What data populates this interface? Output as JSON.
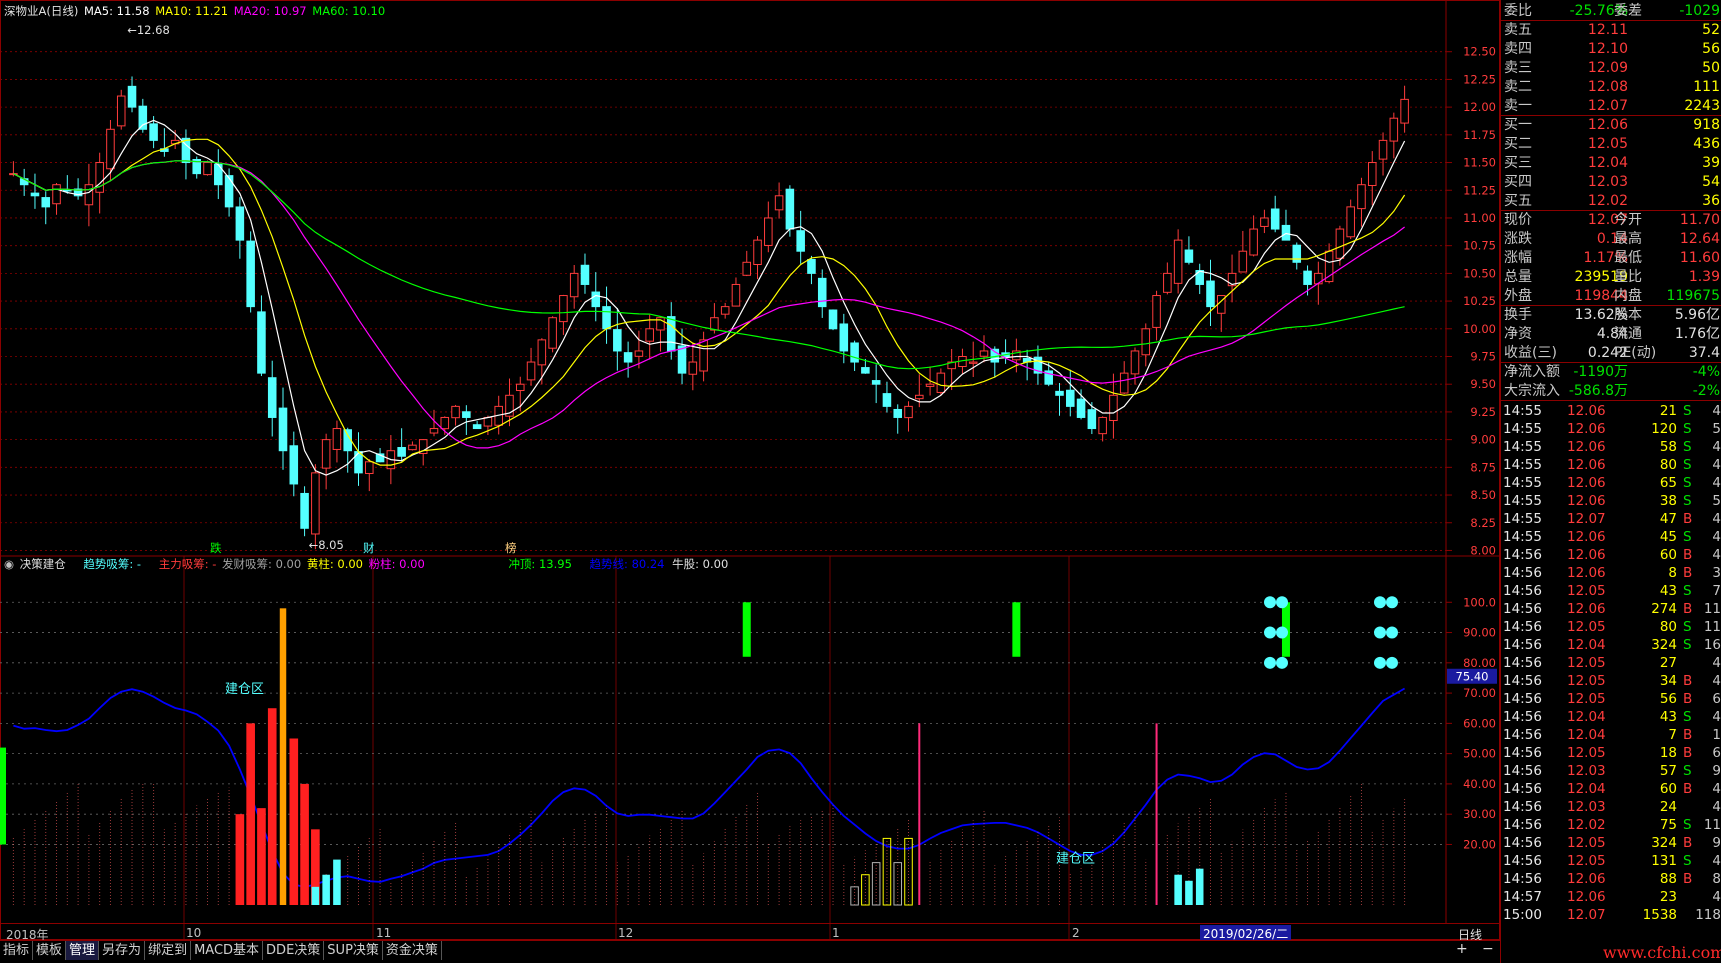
{
  "colors": {
    "up": "#ff3c3c",
    "down": "#54ffff",
    "ma5": "#ffffff",
    "ma10": "#ffff00",
    "ma20": "#ff00ff",
    "ma60": "#00ff00",
    "trend_line": "#0000ff",
    "grid": "#8b0000"
  },
  "main_legend": {
    "title": "深物业A(日线)",
    "ma5": "MA5: 11.58",
    "ma10": "MA10: 11.21",
    "ma20": "MA20: 10.97",
    "ma60": "MA60: 10.10"
  },
  "indicator_legend": {
    "name": "决策建仓",
    "trend": "趋势吸筹: -",
    "main_force": "主力吸筹: -",
    "fortune": "发财吸筹: 0.00",
    "yellow_col": "黄柱: 0.00",
    "pink_col": "粉柱: 0.00",
    "top": "冲顶: 13.95",
    "trend_line": "趋势线: 80.24",
    "bull": "牛股: 0.00"
  },
  "annotations": {
    "high_label": "12.68",
    "low_label": "8.05",
    "event_die": "跌",
    "event_cai": "财",
    "event_bang": "榜",
    "build_zone_1": "建仓区",
    "build_zone_2": "建仓区",
    "current_value": "75.40"
  },
  "price_axis": [
    "12.50",
    "12.25",
    "12.00",
    "11.75",
    "11.50",
    "11.25",
    "11.00",
    "10.75",
    "10.50",
    "10.25",
    "10.00",
    "9.75",
    "9.50",
    "9.25",
    "9.00",
    "8.75",
    "8.50",
    "8.25",
    "8.00"
  ],
  "indicator_axis": [
    "100.0",
    "90.00",
    "80.00",
    "70.00",
    "60.00",
    "50.00",
    "40.00",
    "30.00",
    "20.00"
  ],
  "date_axis": {
    "labels": [
      "2018年",
      "10",
      "11",
      "12",
      "1",
      "2"
    ],
    "cursor_date": "2019/02/26/二",
    "period": "日线"
  },
  "chart_data": {
    "type": "candlestick",
    "title": "深物业A(日线)",
    "ylim": [
      7.95,
      12.75
    ],
    "high": 12.68,
    "low": 8.05,
    "close": [
      11.4,
      11.3,
      11.2,
      11.1,
      11.3,
      11.25,
      11.2,
      11.3,
      11.5,
      11.8,
      12.1,
      12.0,
      11.8,
      11.7,
      11.6,
      11.7,
      11.5,
      11.4,
      11.5,
      11.3,
      11.1,
      10.8,
      10.2,
      9.6,
      9.2,
      8.9,
      8.6,
      8.2,
      8.7,
      9.0,
      9.1,
      8.9,
      8.7,
      8.8,
      8.8,
      8.9,
      8.85,
      8.95,
      9.0,
      9.1,
      9.2,
      9.3,
      9.2,
      9.1,
      9.2,
      9.3,
      9.4,
      9.5,
      9.7,
      9.9,
      10.1,
      10.3,
      10.5,
      10.4,
      10.2,
      10.0,
      9.8,
      9.7,
      9.8,
      10.0,
      10.1,
      9.8,
      9.6,
      9.7,
      9.9,
      10.1,
      10.2,
      10.4,
      10.6,
      10.8,
      11.0,
      11.2,
      10.9,
      10.7,
      10.5,
      10.2,
      10.0,
      9.8,
      9.7,
      9.6,
      9.5,
      9.3,
      9.2,
      9.3,
      9.4,
      9.5,
      9.6,
      9.7,
      9.75,
      9.7,
      9.8,
      9.7,
      9.75,
      9.8,
      9.7,
      9.6,
      9.5,
      9.4,
      9.3,
      9.2,
      9.1,
      9.2,
      9.4,
      9.6,
      9.8,
      10.0,
      10.3,
      10.5,
      10.8,
      10.6,
      10.4,
      10.2,
      10.3,
      10.5,
      10.7,
      10.9,
      11.0,
      10.9,
      10.8,
      10.6,
      10.4,
      10.5,
      10.7,
      10.9,
      11.1,
      11.3,
      11.5,
      11.7,
      11.9,
      12.07
    ],
    "series": [
      {
        "name": "MA5",
        "last": 11.58
      },
      {
        "name": "MA10",
        "last": 11.21
      },
      {
        "name": "MA20",
        "last": 10.97
      },
      {
        "name": "MA60",
        "last": 10.1
      }
    ]
  },
  "right_panel": {
    "header": [
      {
        "l": "委比",
        "v": "-25.76%",
        "vc": "green",
        "l2": "委差",
        "v2": "-1029",
        "v2c": "green"
      }
    ],
    "asks": [
      {
        "l": "卖五",
        "p": "12.11",
        "q": "52"
      },
      {
        "l": "卖四",
        "p": "12.10",
        "q": "56"
      },
      {
        "l": "卖三",
        "p": "12.09",
        "q": "50"
      },
      {
        "l": "卖二",
        "p": "12.08",
        "q": "111"
      },
      {
        "l": "卖一",
        "p": "12.07",
        "q": "2243"
      }
    ],
    "bids": [
      {
        "l": "买一",
        "p": "12.06",
        "q": "918"
      },
      {
        "l": "买二",
        "p": "12.05",
        "q": "436"
      },
      {
        "l": "买三",
        "p": "12.04",
        "q": "39"
      },
      {
        "l": "买四",
        "p": "12.03",
        "q": "54"
      },
      {
        "l": "买五",
        "p": "12.02",
        "q": "36"
      }
    ],
    "stats": [
      {
        "l": "现价",
        "v": "12.07",
        "vc": "red",
        "l2": "今开",
        "v2": "11.70",
        "v2c": "red"
      },
      {
        "l": "涨跌",
        "v": "0.14",
        "vc": "red",
        "l2": "最高",
        "v2": "12.64",
        "v2c": "red"
      },
      {
        "l": "涨幅",
        "v": "1.17%",
        "vc": "red",
        "l2": "最低",
        "v2": "11.60",
        "v2c": "red"
      },
      {
        "l": "总量",
        "v": "239519",
        "vc": "yellow",
        "l2": "量比",
        "v2": "1.39",
        "v2c": "red"
      },
      {
        "l": "外盘",
        "v": "119844",
        "vc": "red",
        "l2": "内盘",
        "v2": "119675",
        "v2c": "green"
      }
    ],
    "stats2": [
      {
        "l": "换手",
        "v": "13.62%",
        "vc": "white",
        "l2": "股本",
        "v2": "5.96亿",
        "v2c": "white"
      },
      {
        "l": "净资",
        "v": "4.84",
        "vc": "white",
        "l2": "流通",
        "v2": "1.76亿",
        "v2c": "white"
      },
      {
        "l": "收益(三)",
        "v": "0.242",
        "vc": "white",
        "l2": "PE(动)",
        "v2": "37.4",
        "v2c": "white"
      }
    ],
    "flows": [
      {
        "l": "净流入额",
        "v": "-1190万",
        "vc": "green",
        "v2": "-4%",
        "v2c": "green"
      },
      {
        "l": "大宗流入",
        "v": "-586.8万",
        "vc": "green",
        "v2": "-2%",
        "v2c": "green"
      }
    ],
    "ticks": [
      {
        "t": "14:55",
        "p": "12.06",
        "pc": "red",
        "q": "21",
        "s": "S",
        "sc": "green",
        "n": "4"
      },
      {
        "t": "14:55",
        "p": "12.06",
        "pc": "red",
        "q": "120",
        "s": "S",
        "sc": "green",
        "n": "5"
      },
      {
        "t": "14:55",
        "p": "12.06",
        "pc": "red",
        "q": "58",
        "s": "S",
        "sc": "green",
        "n": "4"
      },
      {
        "t": "14:55",
        "p": "12.06",
        "pc": "red",
        "q": "80",
        "s": "S",
        "sc": "green",
        "n": "4"
      },
      {
        "t": "14:55",
        "p": "12.06",
        "pc": "red",
        "q": "65",
        "s": "S",
        "sc": "green",
        "n": "4"
      },
      {
        "t": "14:55",
        "p": "12.06",
        "pc": "red",
        "q": "38",
        "s": "S",
        "sc": "green",
        "n": "5"
      },
      {
        "t": "14:55",
        "p": "12.07",
        "pc": "red",
        "q": "47",
        "s": "B",
        "sc": "red",
        "n": "4"
      },
      {
        "t": "14:55",
        "p": "12.06",
        "pc": "red",
        "q": "45",
        "s": "S",
        "sc": "green",
        "n": "4"
      },
      {
        "t": "14:56",
        "p": "12.06",
        "pc": "red",
        "q": "60",
        "s": "B",
        "sc": "red",
        "n": "4"
      },
      {
        "t": "14:56",
        "p": "12.06",
        "pc": "red",
        "q": "8",
        "s": "B",
        "sc": "red",
        "n": "3"
      },
      {
        "t": "14:56",
        "p": "12.05",
        "pc": "red",
        "q": "43",
        "s": "S",
        "sc": "green",
        "n": "7"
      },
      {
        "t": "14:56",
        "p": "12.06",
        "pc": "red",
        "q": "274",
        "s": "B",
        "sc": "red",
        "n": "11"
      },
      {
        "t": "14:56",
        "p": "12.05",
        "pc": "red",
        "q": "80",
        "s": "S",
        "sc": "green",
        "n": "11"
      },
      {
        "t": "14:56",
        "p": "12.04",
        "pc": "red",
        "q": "324",
        "s": "S",
        "sc": "green",
        "n": "16"
      },
      {
        "t": "14:56",
        "p": "12.05",
        "pc": "red",
        "q": "27",
        "s": "",
        "sc": "red",
        "n": "4"
      },
      {
        "t": "14:56",
        "p": "12.05",
        "pc": "red",
        "q": "34",
        "s": "B",
        "sc": "red",
        "n": "4"
      },
      {
        "t": "14:56",
        "p": "12.05",
        "pc": "red",
        "q": "56",
        "s": "B",
        "sc": "red",
        "n": "6"
      },
      {
        "t": "14:56",
        "p": "12.04",
        "pc": "red",
        "q": "43",
        "s": "S",
        "sc": "green",
        "n": "4"
      },
      {
        "t": "14:56",
        "p": "12.04",
        "pc": "red",
        "q": "7",
        "s": "B",
        "sc": "red",
        "n": "1"
      },
      {
        "t": "14:56",
        "p": "12.05",
        "pc": "red",
        "q": "18",
        "s": "B",
        "sc": "red",
        "n": "6"
      },
      {
        "t": "14:56",
        "p": "12.03",
        "pc": "red",
        "q": "57",
        "s": "S",
        "sc": "green",
        "n": "9"
      },
      {
        "t": "14:56",
        "p": "12.04",
        "pc": "red",
        "q": "60",
        "s": "B",
        "sc": "red",
        "n": "4"
      },
      {
        "t": "14:56",
        "p": "12.03",
        "pc": "red",
        "q": "24",
        "s": "",
        "sc": "red",
        "n": "4"
      },
      {
        "t": "14:56",
        "p": "12.02",
        "pc": "red",
        "q": "75",
        "s": "S",
        "sc": "green",
        "n": "11"
      },
      {
        "t": "14:56",
        "p": "12.05",
        "pc": "red",
        "q": "324",
        "s": "B",
        "sc": "red",
        "n": "9"
      },
      {
        "t": "14:56",
        "p": "12.05",
        "pc": "red",
        "q": "131",
        "s": "S",
        "sc": "green",
        "n": "4"
      },
      {
        "t": "14:56",
        "p": "12.06",
        "pc": "red",
        "q": "88",
        "s": "B",
        "sc": "red",
        "n": "8"
      },
      {
        "t": "14:57",
        "p": "12.06",
        "pc": "red",
        "q": "23",
        "s": "",
        "sc": "red",
        "n": "4"
      },
      {
        "t": "15:00",
        "p": "12.07",
        "pc": "red",
        "q": "1538",
        "s": "",
        "sc": "red",
        "n": "118"
      }
    ]
  },
  "tabs": [
    "指标",
    "模板",
    "管理",
    "另存为",
    "绑定到",
    "MACD基本",
    "DDE决策",
    "SUP决策",
    "资金决策"
  ],
  "bottom_controls": {
    "plus": "+",
    "minus": "−"
  },
  "watermark": "www.cfchi.com"
}
